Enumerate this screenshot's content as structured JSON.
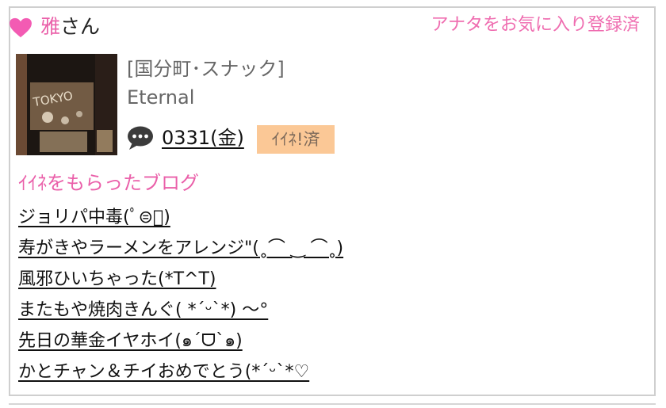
{
  "header": {
    "user_name": "雅",
    "honorific": "さん",
    "favorite_status": "アナタをお気に入り登録済"
  },
  "colors": {
    "accent_pink": "#ea5fa9",
    "badge_bg": "#fbc896"
  },
  "icons": {
    "heart": "heart-icon",
    "chat": "speech-bubble-icon"
  },
  "shop": {
    "area_type": "[国分町･スナック]",
    "name": "Eternal",
    "thumbnail_text": "TOKYO"
  },
  "visit": {
    "date": "0331(金)",
    "iine_badge": "ｲｲﾈ!済"
  },
  "blog": {
    "heading": "ｲｲﾈをもらったブログ",
    "posts": [
      "ジョリパ中毒(ﾟ⊜ﾟ)",
      "寿がきやラーメンをアレンジ\"(˳⌒ ‿ ⌒˳)",
      "風邪ひいちゃった(*T^T)",
      "またもや焼肉きんぐ( *´ᵕ`*) 〜°",
      "先日の華金イヤホイ(๑´ᗜ`๑)",
      "かとチャン＆チイおめでとう(*´ᵕ`*♡"
    ]
  }
}
